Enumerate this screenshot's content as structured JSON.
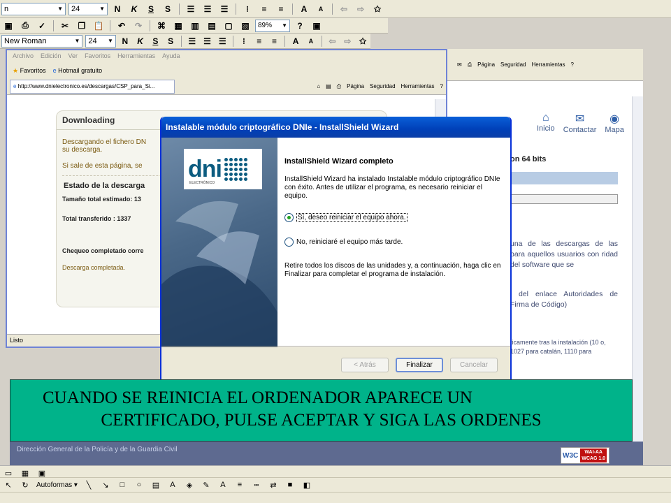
{
  "toolbar1": {
    "font": "n",
    "size": "24",
    "bold": "N",
    "italic": "K",
    "underline": "S",
    "shadow": "S",
    "zoom": "89%"
  },
  "toolbar2": {
    "font": "New Roman",
    "size": "24",
    "bold": "N",
    "italic": "K",
    "underline": "S",
    "shadow": "S"
  },
  "ie_left": {
    "menu": [
      "Archivo",
      "Edición",
      "Ver",
      "Favoritos",
      "Herramientas",
      "Ayuda"
    ],
    "favorites": "Favoritos",
    "hotmail": "Hotmail gratuito",
    "tab_url": "http://www.dnielectronico.es/descargas/CSP_para_Si...",
    "cmds": [
      "Página",
      "Seguridad",
      "Herramientas"
    ],
    "status": "Listo",
    "download": {
      "title": "Downloading",
      "line1": "Descargando el fichero DN",
      "line2": "su descarga.",
      "line3": "Si sale de esta página, se",
      "state_title": "Estado de la descarga",
      "total_est": "Tamaño total estimado: 13",
      "transferred": "Total transferido    : 1337",
      "check": "Chequeo completado corre",
      "complete": "Descarga completada."
    }
  },
  "ie_right": {
    "cmds": [
      "Página",
      "Seguridad",
      "Herramientas"
    ],
    "nav": [
      "Inicio",
      "Contactar",
      "Mapa"
    ],
    "heading": "on 64 bits",
    "para1": "una de las descargas de las para aquellos usuarios con ridad del software que se",
    "para2": "' del enlace Autoridades de Firma de Código)",
    "small": "ticamente tras la instalación (10 o, 1027 para catalán, 1110 para",
    "footer": "Dirección General de la Policía y de la Guardia Civil",
    "wai_w3c": "W3C",
    "wai_level": "WAI-AA",
    "wai_wcag": "WCAG 1.0"
  },
  "wizard": {
    "title": "Instalable módulo criptográfico DNIe - InstallShield Wizard",
    "logo_text": "dni",
    "logo_sub": "ELECTRÓNICO",
    "heading": "InstallShield Wizard completo",
    "body": "InstallShield Wizard ha instalado  Instalable módulo criptográfico DNIe con éxito. Antes de utilizar el programa, es necesario reiniciar el equipo.",
    "option_yes": "Sí, deseo reiniciar el equipo ahora.",
    "option_no": "No, reiniciaré el equipo más tarde.",
    "footer_text": "Retire todos los discos de las unidades y, a continuación, haga clic en Finalizar para completar el programa de instalación.",
    "back": "< Atrás",
    "finish": "Finalizar",
    "cancel": "Cancelar"
  },
  "caption": {
    "line1": "CUANDO SE REINICIA EL ORDENADOR APARECE UN",
    "line2": "CERTIFICADO, PULSE ACEPTAR Y SIGA LAS ORDENES"
  },
  "drawbar": {
    "autoshapes": "Autoformas"
  }
}
